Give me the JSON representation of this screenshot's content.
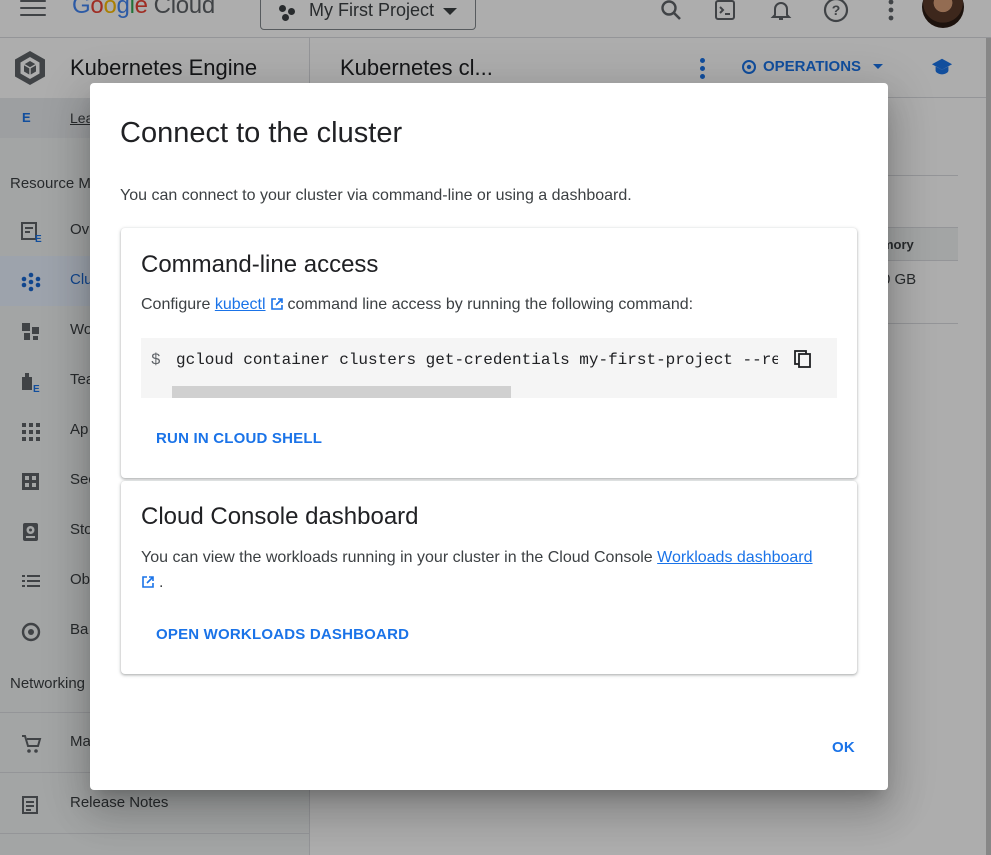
{
  "topbar": {
    "logo_letters": [
      "G",
      "o",
      "o",
      "g",
      "l",
      "e"
    ],
    "logo_suffix": "Cloud",
    "project_name": "My First Project",
    "icons": [
      "search-icon",
      "cloud-shell-icon",
      "notifications-icon",
      "help-icon",
      "more-vert-icon",
      "account-avatar"
    ]
  },
  "sidebar": {
    "product_title": "Kubernetes Engine",
    "enterprise_badge": "E",
    "enterprise_link": "Lea",
    "section_resource": "Resource M",
    "items": [
      {
        "label": "Ov",
        "icon": "overview-icon"
      },
      {
        "label": "Clu",
        "icon": "clusters-icon",
        "active": true
      },
      {
        "label": "Wo",
        "icon": "workloads-icon"
      },
      {
        "label": "Tea",
        "icon": "teams-icon"
      },
      {
        "label": "Ap",
        "icon": "applications-icon"
      },
      {
        "label": "Sec",
        "icon": "secrets-icon"
      },
      {
        "label": "Sto",
        "icon": "storage-icon"
      },
      {
        "label": "Ob",
        "icon": "object-browser-icon"
      },
      {
        "label": "Ba",
        "icon": "backup-icon"
      }
    ],
    "section_networking": "Networking",
    "bottom_items": [
      {
        "label": "Ma",
        "icon": "marketplace-icon"
      },
      {
        "label": "Release Notes",
        "icon": "release-notes-icon"
      }
    ]
  },
  "main": {
    "title": "Kubernetes cl...",
    "operations_label": "OPERATIONS",
    "table_header": "mory",
    "table_cell": "0 GB"
  },
  "dialog": {
    "title": "Connect to the cluster",
    "description": "You can connect to your cluster via command-line or using a dashboard.",
    "cli": {
      "heading": "Command-line access",
      "text_before": "Configure",
      "link": "kubectl",
      "text_after": "command line access by running the following command:",
      "prompt": "$",
      "command": "gcloud container clusters get-credentials my-first-project --region",
      "run_button": "RUN IN CLOUD SHELL"
    },
    "dashboard": {
      "heading": "Cloud Console dashboard",
      "text_before": "You can view the workloads running in your cluster in the Cloud Console",
      "link": "Workloads dashboard",
      "text_after": ".",
      "open_button": "OPEN WORKLOADS DASHBOARD"
    },
    "ok_button": "OK"
  },
  "colors": {
    "accent": "#1a73e8",
    "scrim": "rgba(0,0,0,0.32)",
    "code_bg": "#f5f5f5"
  }
}
